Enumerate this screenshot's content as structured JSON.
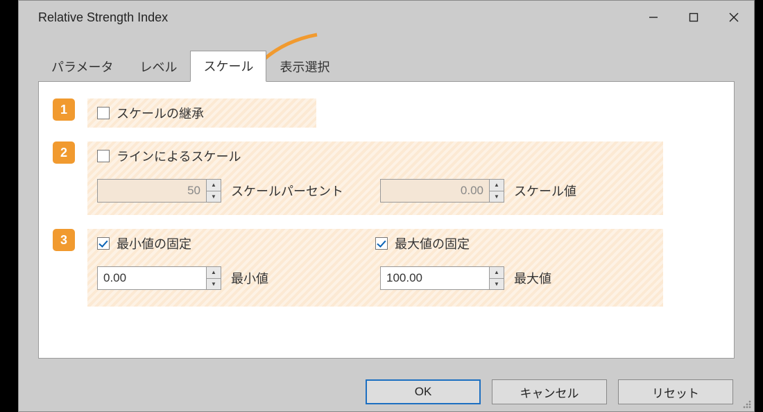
{
  "window": {
    "title": "Relative Strength Index"
  },
  "tabs": {
    "t0": "パラメータ",
    "t1": "レベル",
    "t2": "スケール",
    "t3": "表示選択"
  },
  "badges": {
    "b1": "1",
    "b2": "2",
    "b3": "3"
  },
  "section1": {
    "inherit_scale": "スケールの継承"
  },
  "section2": {
    "scale_by_line": "ラインによるスケール",
    "scale_percent_value": "50",
    "scale_percent_label": "スケールパーセント",
    "scale_value_value": "0.00",
    "scale_value_label": "スケール値"
  },
  "section3": {
    "fix_min": "最小値の固定",
    "fix_max": "最大値の固定",
    "min_value": "0.00",
    "min_label": "最小値",
    "max_value": "100.00",
    "max_label": "最大値"
  },
  "buttons": {
    "ok": "OK",
    "cancel": "キャンセル",
    "reset": "リセット"
  }
}
